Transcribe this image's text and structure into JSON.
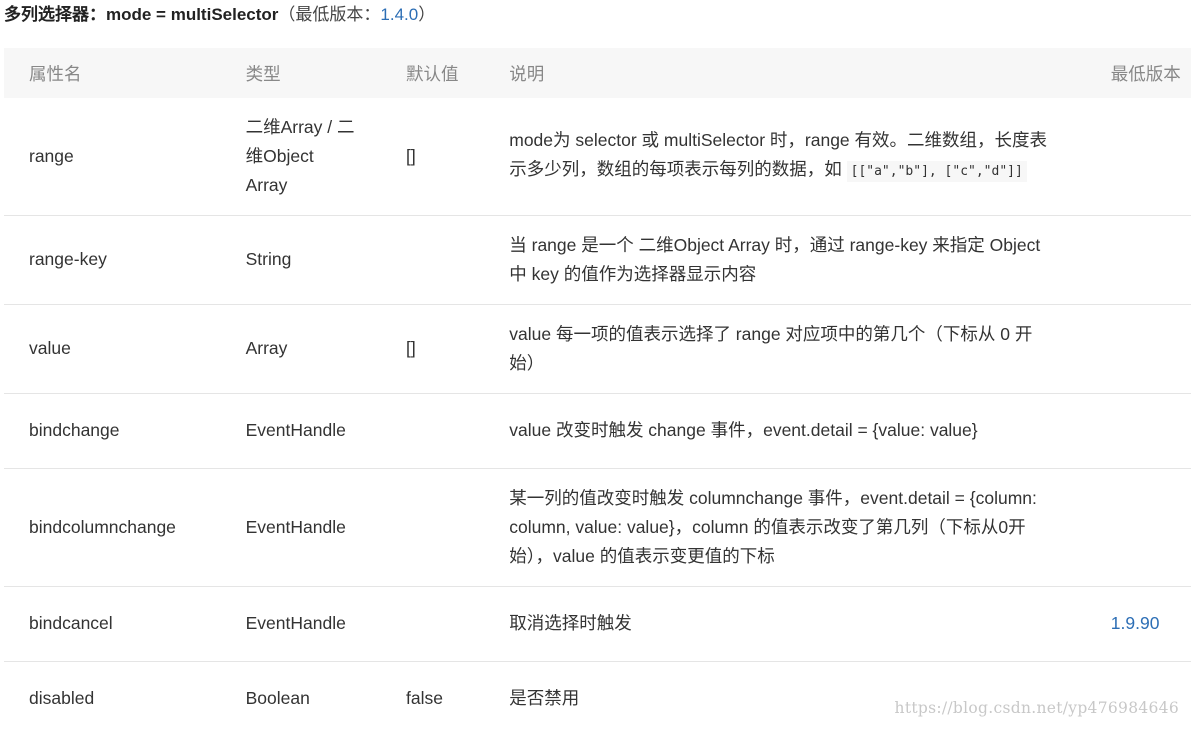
{
  "heading": {
    "bold": "多列选择器：mode = multiSelector",
    "paren_open": "（最低版本：",
    "version": "1.4.0",
    "paren_close": "）"
  },
  "table": {
    "headers": [
      "属性名",
      "类型",
      "默认值",
      "说明",
      "最低版本"
    ],
    "rows": [
      {
        "name": "range",
        "type": "二维Array / 二维Object Array",
        "default": "[]",
        "desc": "mode为 selector 或 multiSelector 时，range 有效。二维数组，长度表示多少列，数组的每项表示每列的数据，如 ",
        "desc_code": "[[\"a\",\"b\"], [\"c\",\"d\"]]",
        "version": ""
      },
      {
        "name": "range-key",
        "type": "String",
        "default": "",
        "desc": "当 range 是一个 二维Object Array 时，通过 range-key 来指定 Object 中 key 的值作为选择器显示内容",
        "version": ""
      },
      {
        "name": "value",
        "type": "Array",
        "default": "[]",
        "desc": "value 每一项的值表示选择了 range 对应项中的第几个（下标从 0 开始）",
        "version": ""
      },
      {
        "name": "bindchange",
        "type": "EventHandle",
        "default": "",
        "desc": "value 改变时触发 change 事件，event.detail = {value: value}",
        "version": ""
      },
      {
        "name": "bindcolumnchange",
        "type": "EventHandle",
        "default": "",
        "desc": "某一列的值改变时触发 columnchange 事件，event.detail = {column: column, value: value}，column 的值表示改变了第几列（下标从0开始），value 的值表示变更值的下标",
        "version": ""
      },
      {
        "name": "bindcancel",
        "type": "EventHandle",
        "default": "",
        "desc": "取消选择时触发",
        "version": "1.9.90"
      },
      {
        "name": "disabled",
        "type": "Boolean",
        "default": "false",
        "desc": "是否禁用",
        "version": ""
      }
    ]
  },
  "watermark": "https://blog.csdn.net/yp476984646",
  "colors": {
    "link": "#2c6eb5",
    "header_bg": "#f7f7f7",
    "header_text": "#888888",
    "body_text": "#333333",
    "border": "#e5e5e5"
  }
}
